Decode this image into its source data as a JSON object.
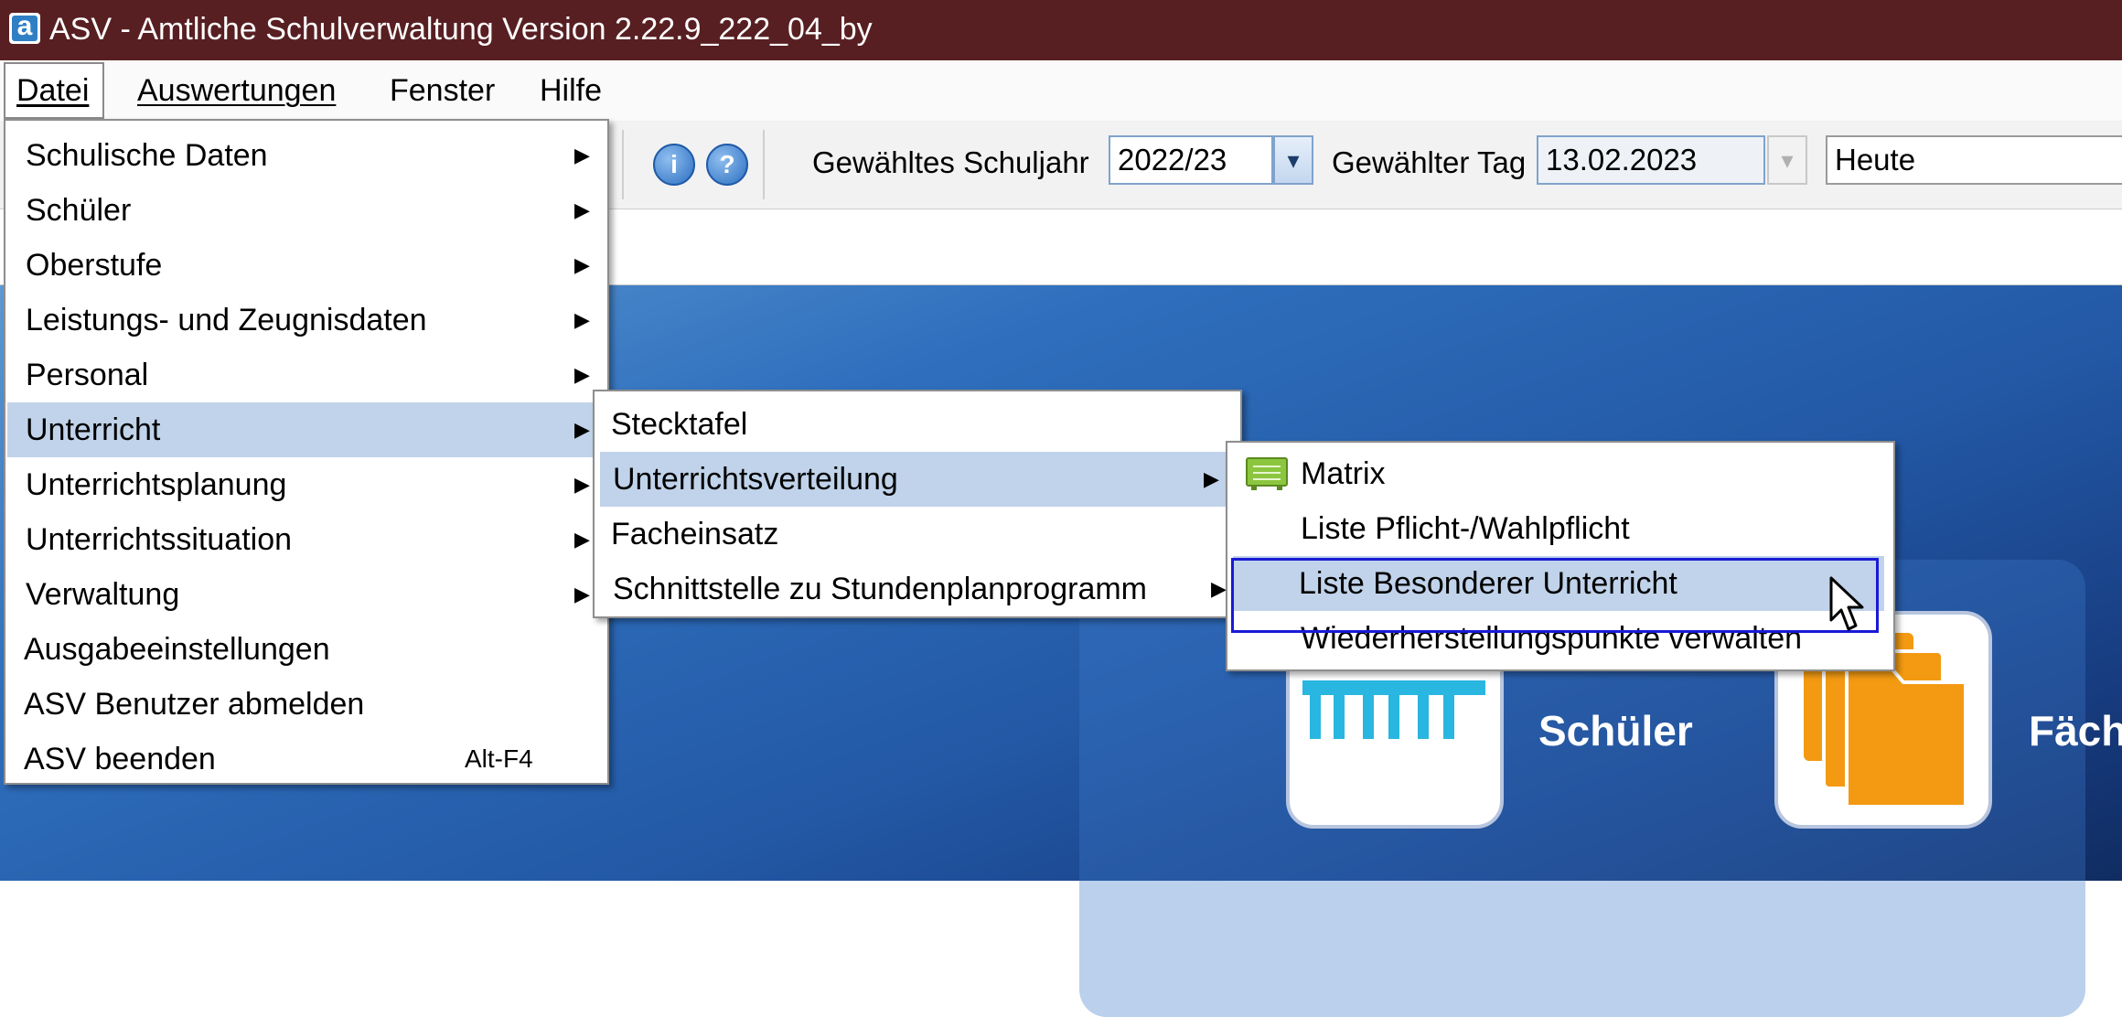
{
  "window": {
    "title": "ASV - Amtliche Schulverwaltung Version 2.22.9_222_04_by",
    "app_icon_letter": "a"
  },
  "menubar": {
    "items": [
      {
        "label": "Datei"
      },
      {
        "label": "Auswertungen"
      },
      {
        "label": "Fenster"
      },
      {
        "label": "Hilfe"
      }
    ]
  },
  "toolbar": {
    "info_icon": "info-icon",
    "help_icon": "help-icon",
    "schuljahr_label": "Gewähltes Schuljahr",
    "schuljahr_value": "2022/23",
    "tag_label": "Gewählter Tag",
    "tag_value": "13.02.2023",
    "heute_value": "Heute"
  },
  "datei_menu": {
    "items": [
      {
        "label": "Schulische Daten",
        "has_submenu": true
      },
      {
        "label": "Schüler",
        "has_submenu": true
      },
      {
        "label": "Oberstufe",
        "has_submenu": true
      },
      {
        "label": "Leistungs- und Zeugnisdaten",
        "has_submenu": true
      },
      {
        "label": "Personal",
        "has_submenu": true
      },
      {
        "label": "Unterricht",
        "has_submenu": true,
        "selected": true
      },
      {
        "label": "Unterrichtsplanung",
        "has_submenu": true
      },
      {
        "label": "Unterrichtssituation",
        "has_submenu": true
      },
      {
        "label": "Verwaltung",
        "has_submenu": true
      },
      {
        "label": "Ausgabeeinstellungen",
        "has_submenu": false
      },
      {
        "label": "ASV Benutzer abmelden",
        "has_submenu": false
      },
      {
        "label": "ASV beenden",
        "has_submenu": false,
        "shortcut": "Alt-F4"
      }
    ]
  },
  "unterricht_menu": {
    "items": [
      {
        "label": "Stecktafel",
        "has_submenu": false
      },
      {
        "label": "Unterrichtsverteilung",
        "has_submenu": true,
        "selected": true
      },
      {
        "label": "Facheinsatz",
        "has_submenu": false
      },
      {
        "label": "Schnittstelle zu Stundenplanprogramm",
        "has_submenu": true
      }
    ]
  },
  "verteilung_menu": {
    "items": [
      {
        "label": "Matrix",
        "icon": "matrix-icon"
      },
      {
        "label": "Liste Pflicht-/Wahlpflicht"
      },
      {
        "label": "Liste Besonderer Unterricht",
        "selected": true
      },
      {
        "label": "Wiederherstellungspunkte verwalten"
      }
    ]
  },
  "desktop": {
    "tiles": [
      {
        "label": "Schüler",
        "icon": "students-icon"
      },
      {
        "label": "Fäch",
        "icon": "folders-icon"
      }
    ]
  },
  "colors": {
    "titlebar": "#581f22",
    "menu_selection": "#c0d3ea",
    "focus_border": "#1a1ad6",
    "tile_blue": "#29b6e0",
    "tile_orange": "#f39a12"
  }
}
